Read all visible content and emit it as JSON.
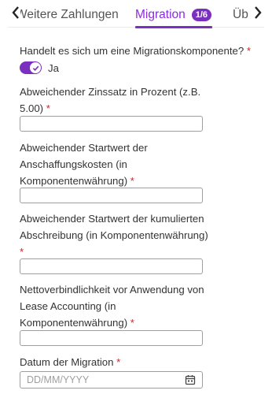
{
  "tabs": {
    "prev_label": "Weitere Zahlungen",
    "active_label": "Migration",
    "active_badge": "1/6",
    "next_label": "Übersicht"
  },
  "form": {
    "q_migration": {
      "label": "Handelt es sich um eine Migrationskomponente?",
      "required_mark": "*",
      "toggle_on": true,
      "toggle_text": "Ja"
    },
    "zinssatz": {
      "label": "Abweichender Zinssatz in Prozent (z.B. 5.00)",
      "required_mark": "*",
      "value": ""
    },
    "anschaffungskosten": {
      "label": "Abweichender Startwert der Anschaffungskosten (in Komponentenwährung)",
      "required_mark": "*",
      "value": ""
    },
    "abschreibung": {
      "label": "Abweichender Startwert der kumulierten Abschreibung (in Komponentenwährung)",
      "required_mark": "*",
      "value": ""
    },
    "nettoverbindlichkeit": {
      "label": "Nettoverbindlichkeit vor Anwendung von Lease Accounting (in Komponentenwährung)",
      "required_mark": "*",
      "value": ""
    },
    "datum": {
      "label": "Datum der Migration",
      "required_mark": "*",
      "placeholder": "DD/MM/YYYY"
    }
  },
  "colors": {
    "accent": "#7b2fbe",
    "required": "#c62828",
    "border": "#9e9e9e"
  }
}
